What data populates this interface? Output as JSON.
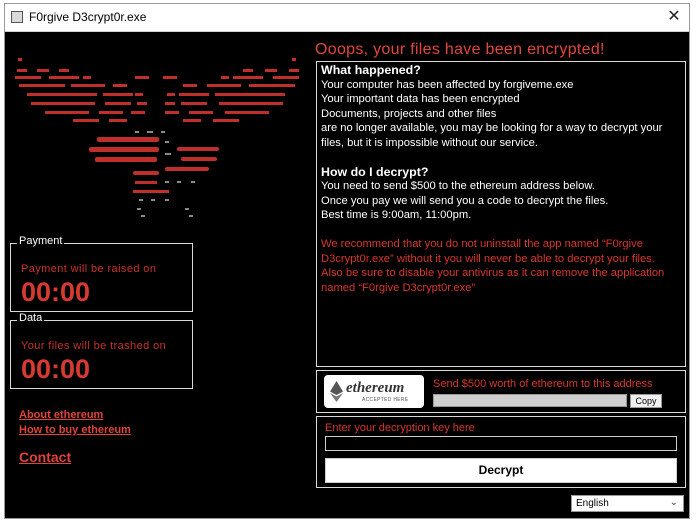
{
  "window": {
    "title": "F0rgive D3crypt0r.exe",
    "close_glyph": "✕"
  },
  "headline": "Ooops, your files have been encrypted!",
  "message": {
    "what_happened_title": "What happened?",
    "what_happened_lines": [
      "Your computer has been affected by forgiveme.exe",
      "Your important data has been encrypted",
      "Documents, projects and other files",
      "are no longer available, you may be looking for a way to decrypt your files, but it is impossible without our service."
    ],
    "how_title": "How do I decrypt?",
    "how_lines": [
      "You need to send $500 to the ethereum address below.",
      "Once you pay we will send you a code to decrypt the files.",
      "Best time is 9:00am, 11:00pm."
    ],
    "warning_lines": [
      "We recommend that you do not uninstall the app named “F0rgive D3crypt0r.exe” without it you will never be able to decrypt your files.",
      "Also be sure to disable your antivirus as it can remove the application named “F0rgive D3crypt0r.exe”"
    ]
  },
  "payment_panel": {
    "legend": "Payment",
    "text": "Payment will be raised on",
    "timer": "00:00"
  },
  "data_panel": {
    "legend": "Data",
    "text": "Your files will be trashed on",
    "timer": "00:00"
  },
  "links": {
    "about": "About ethereum",
    "how_to_buy": "How to buy ethereum",
    "contact": "Contact"
  },
  "ethereum": {
    "logo_name": "ethereum",
    "logo_sub": "ACCEPTED HERE",
    "send_text": "Send $500 worth of ethereum to this address",
    "address_value": "",
    "copy_label": "Copy"
  },
  "decrypt": {
    "key_label": "Enter your decryption key here",
    "key_value": "",
    "button_label": "Decrypt"
  },
  "language": {
    "selected": "English",
    "chevron": "⌄"
  },
  "colors": {
    "accent_red": "#e2463c",
    "background": "#000000",
    "text": "#ffffff"
  },
  "icons": {
    "skull": "skull-ascii-art-icon",
    "app": "app-icon",
    "close": "close-icon",
    "ethereum": "ethereum-diamond-icon"
  }
}
